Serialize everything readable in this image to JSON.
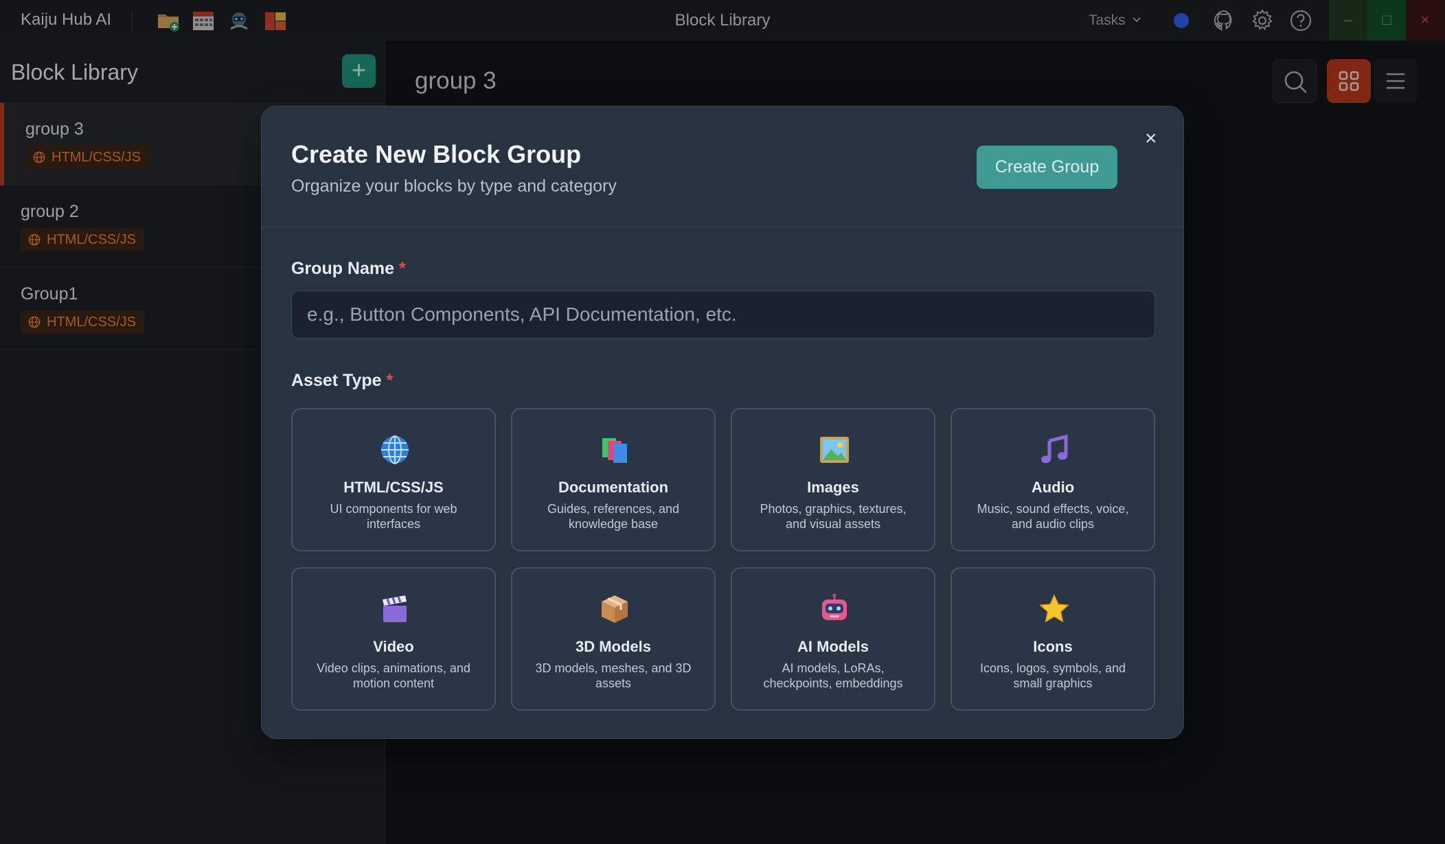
{
  "titlebar": {
    "app_name": "Kaiju Hub AI",
    "window_title": "Block Library",
    "tasks_label": "Tasks",
    "toolbar_icons": [
      "folder-add-icon",
      "calendar-grid-icon",
      "robot-icon",
      "blocks-icon"
    ],
    "right_icons": [
      "status-dot",
      "github-icon",
      "gear-icon",
      "help-icon"
    ]
  },
  "sidebar": {
    "title": "Block Library",
    "add_label": "+",
    "groups": [
      {
        "name": "group 3",
        "badge": "HTML/CSS/JS",
        "active": true
      },
      {
        "name": "group 2",
        "badge": "HTML/CSS/JS",
        "active": false
      },
      {
        "name": "Group1",
        "badge": "HTML/CSS/JS",
        "active": false
      }
    ]
  },
  "main": {
    "title": "group 3"
  },
  "modal": {
    "title": "Create New Block Group",
    "subtitle": "Organize your blocks by type and category",
    "create_button": "Create Group",
    "close": "×",
    "name_label": "Group Name",
    "required_mark": "*",
    "name_placeholder": "e.g., Button Components, API Documentation, etc.",
    "name_value": "",
    "asset_label": "Asset Type",
    "asset_types": [
      {
        "title": "HTML/CSS/JS",
        "desc": "UI components for web interfaces",
        "icon": "globe-icon"
      },
      {
        "title": "Documentation",
        "desc": "Guides, references, and knowledge base",
        "icon": "documents-icon"
      },
      {
        "title": "Images",
        "desc": "Photos, graphics, textures, and visual assets",
        "icon": "picture-icon"
      },
      {
        "title": "Audio",
        "desc": "Music, sound effects, voice, and audio clips",
        "icon": "music-note-icon"
      },
      {
        "title": "Video",
        "desc": "Video clips, animations, and motion content",
        "icon": "clapperboard-icon"
      },
      {
        "title": "3D Models",
        "desc": "3D models, meshes, and 3D assets",
        "icon": "package-icon"
      },
      {
        "title": "AI Models",
        "desc": "AI models, LoRAs, checkpoints, embeddings",
        "icon": "robot-icon"
      },
      {
        "title": "Icons",
        "desc": "Icons, logos, symbols, and small graphics",
        "icon": "star-icon"
      }
    ]
  },
  "colors": {
    "accent_teal": "#1f8f7a",
    "accent_orange": "#b3371b",
    "badge_text": "#ea7b2d",
    "modal_bg": "#283342",
    "create_button": "#3f9a94",
    "required": "#e5484d"
  }
}
